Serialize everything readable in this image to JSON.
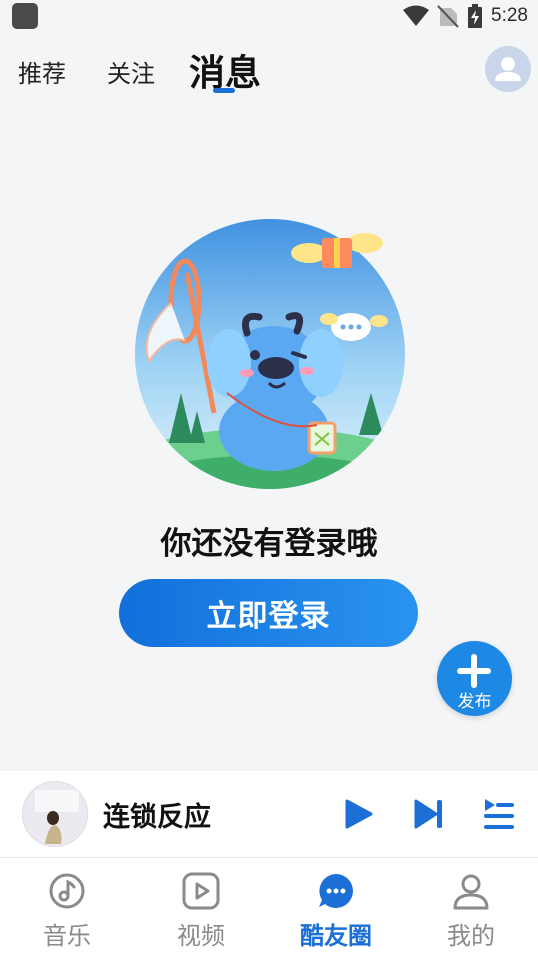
{
  "status_bar": {
    "time": "5:28"
  },
  "top_tabs": [
    {
      "label": "推荐"
    },
    {
      "label": "关注"
    },
    {
      "label": "消息"
    }
  ],
  "main": {
    "login_prompt": "你还没有登录哦",
    "login_button": "立即登录"
  },
  "fab": {
    "label": "发布"
  },
  "player": {
    "title": "连锁反应"
  },
  "bottom_nav": [
    {
      "label": "音乐",
      "icon": "music-note-icon"
    },
    {
      "label": "视频",
      "icon": "play-square-icon"
    },
    {
      "label": "酷友圈",
      "icon": "chat-bubble-icon",
      "active": true
    },
    {
      "label": "我的",
      "icon": "person-icon"
    }
  ],
  "colors": {
    "accent": "#1b6fd6",
    "background": "#f4f5f7",
    "inactive": "#8a8a8a"
  }
}
